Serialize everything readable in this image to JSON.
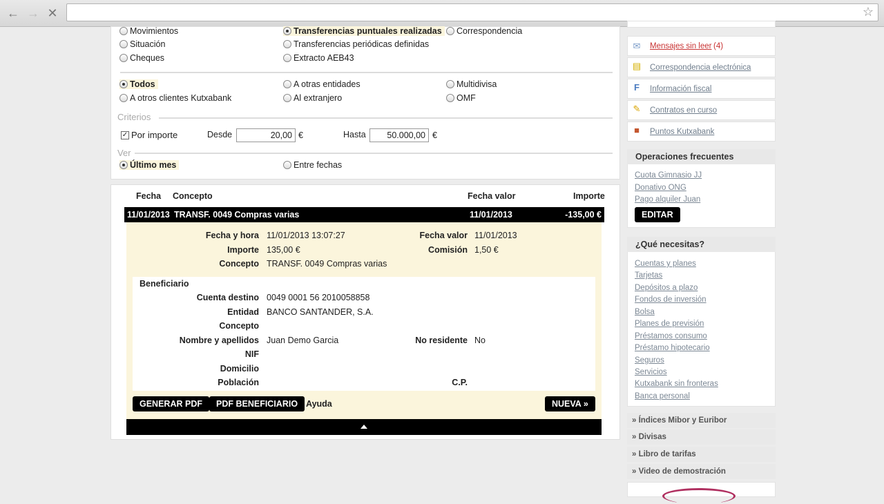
{
  "browser": {
    "back_icon": "arrow-left-icon",
    "forward_icon": "arrow-right-icon",
    "stop_icon": "close-icon",
    "star_icon": "star-icon",
    "url": ""
  },
  "filters": {
    "type_options": [
      {
        "label": "Movimientos",
        "selected": false
      },
      {
        "label": "Situación",
        "selected": false
      },
      {
        "label": "Cheques",
        "selected": false
      },
      {
        "label": "Transferencias puntuales realizadas",
        "selected": true
      },
      {
        "label": "Transferencias periódicas definidas",
        "selected": false
      },
      {
        "label": "Extracto AEB43",
        "selected": false
      },
      {
        "label": "Correspondencia",
        "selected": false
      }
    ],
    "dest_options": [
      {
        "label": "Todos",
        "selected": true
      },
      {
        "label": "A otros clientes Kutxabank",
        "selected": false
      },
      {
        "label": "A otras entidades",
        "selected": false
      },
      {
        "label": "Al extranjero",
        "selected": false
      },
      {
        "label": "Multidivisa",
        "selected": false
      },
      {
        "label": "OMF",
        "selected": false
      }
    ],
    "criterios_label": "Criterios",
    "por_importe_label": "Por importe",
    "por_importe_checked": true,
    "desde_label": "Desde",
    "desde_value": "20,00",
    "hasta_label": "Hasta",
    "hasta_value": "50.000,00",
    "currency": "€",
    "ver_label": "Ver",
    "ver_options": [
      {
        "label": "Último mes",
        "selected": true
      },
      {
        "label": "Entre fechas",
        "selected": false
      }
    ]
  },
  "results": {
    "headers": {
      "fecha": "Fecha",
      "concepto": "Concepto",
      "fecha_valor": "Fecha valor",
      "importe": "Importe"
    },
    "row": {
      "fecha": "11/01/2013",
      "concepto": "TRANSF. 0049 Compras varias",
      "fecha_valor": "11/01/2013",
      "importe": "-135,00 €"
    },
    "detail": {
      "fecha_hora_label": "Fecha y hora",
      "fecha_hora": "11/01/2013 13:07:27",
      "fecha_valor_label": "Fecha valor",
      "fecha_valor": "11/01/2013",
      "importe_label": "Importe",
      "importe": "135,00 €",
      "comision_label": "Comisión",
      "comision": "1,50 €",
      "concepto_label": "Concepto",
      "concepto": "TRANSF. 0049 Compras varias"
    },
    "beneficiario": {
      "title": "Beneficiario",
      "cuenta_label": "Cuenta destino",
      "cuenta": "0049 0001 56 2010058858",
      "entidad_label": "Entidad",
      "entidad": "BANCO SANTANDER, S.A.",
      "concepto_label": "Concepto",
      "concepto": "",
      "nombre_label": "Nombre y apellidos",
      "nombre": "Juan Demo Garcia",
      "no_residente_label": "No residente",
      "no_residente": "No",
      "nif_label": "NIF",
      "domicilio_label": "Domicilio",
      "poblacion_label": "Población",
      "cp_label": "C.P."
    },
    "buttons": {
      "generar_pdf": "GENERAR PDF",
      "pdf_beneficiario": "PDF BENEFICIARIO",
      "ayuda": "Ayuda",
      "nueva": "NUEVA »"
    }
  },
  "sidebar": {
    "links": [
      {
        "label": "Mensajes sin leer",
        "count": "(4)",
        "icon": "envelope-icon"
      },
      {
        "label": "Correspondencia electrónica",
        "icon": "document-icon"
      },
      {
        "label": "Información fiscal",
        "icon": "fiscal-icon"
      },
      {
        "label": "Contratos en curso",
        "icon": "pencil-icon"
      },
      {
        "label": "Puntos Kutxabank",
        "icon": "gift-icon"
      }
    ],
    "frecuentes_title": "Operaciones frecuentes",
    "frecuentes": [
      "Cuota Gimnasio JJ",
      "Donativo ONG",
      "Pago alquiler Juan"
    ],
    "editar": "EDITAR",
    "necesitas_title": "¿Qué necesitas?",
    "necesitas": [
      "Cuentas y planes",
      "Tarjetas",
      "Depósitos a plazo",
      "Fondos de inversión",
      "Bolsa",
      "Planes de previsión",
      "Préstamos consumo",
      "Préstamo hipotecario",
      "Seguros",
      "Servicios",
      "Kutxabank sin fronteras",
      "Banca personal"
    ],
    "collapsibles": [
      "» Índices Mibor y Euribor",
      "» Divisas",
      "» Libro de tarifas",
      "» Video de demostración"
    ]
  }
}
